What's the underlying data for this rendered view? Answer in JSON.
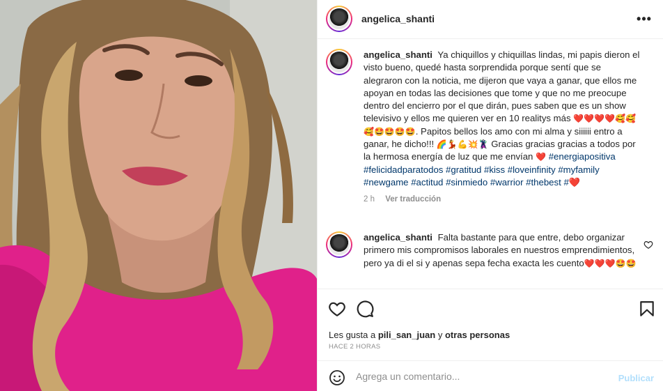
{
  "colors": {
    "accent_link": "#00376b",
    "post_disabled": "#b2dffc",
    "muted": "#8e8e8e",
    "top_fill": "#e0218a"
  },
  "photo": {
    "icon": "selfie-photo"
  },
  "header": {
    "username": "angelica_shanti",
    "more_icon": "more-horizontal-icon",
    "more_label": "•••"
  },
  "caption": {
    "username": "angelica_shanti",
    "text1": "Ya chiquillos y chiquillas lindas, mi papis dieron el visto bueno, quedé hasta sorprendida porque sentí que se alegraron con la noticia, me dijeron que vaya a ganar, que ellos me apoyan en todas las decisiones que tome y que no me preocupe dentro del encierro por el que dirán, pues saben que es un show televisivo y ellos me quieren ver en 10 realitys más",
    "emojis1": "❤️❤️❤️❤️🥰🥰🥰🤩🤩🤩🤩",
    "text2": ". Papitos bellos los amo con mi alma y siiiiii entro a ganar, he dicho!!!",
    "emojis2": "🌈💃💪💥🦹",
    "text3": "Gracias gracias gracias a todos por la hermosa energía de luz que me envían",
    "emojis3": "❤️",
    "hashtags": [
      "#energiapositiva",
      "#felicidadparatodos",
      "#gratitud",
      "#kiss",
      "#loveinfinity",
      "#myfamily",
      "#newgame",
      "#actitud",
      "#sinmiedo",
      "#warrior",
      "#thebest",
      "#❤️"
    ],
    "time": "2 h",
    "translate": "Ver traducción"
  },
  "comment": {
    "username": "angelica_shanti",
    "text": "Falta bastante para que entre, debo organizar primero mis compromisos laborales en nuestros emprendimientos, pero ya di el si y apenas sepa fecha exacta les cuento",
    "emojis": "❤️❤️❤️🤩🤩"
  },
  "actions": {
    "likes_prefix": "Les gusta a",
    "likes_user": "pili_san_juan",
    "likes_mid": "y",
    "likes_others": "otras personas",
    "timestamp": "HACE 2 HORAS"
  },
  "add_comment": {
    "placeholder": "Agrega un comentario...",
    "post_label": "Publicar"
  }
}
